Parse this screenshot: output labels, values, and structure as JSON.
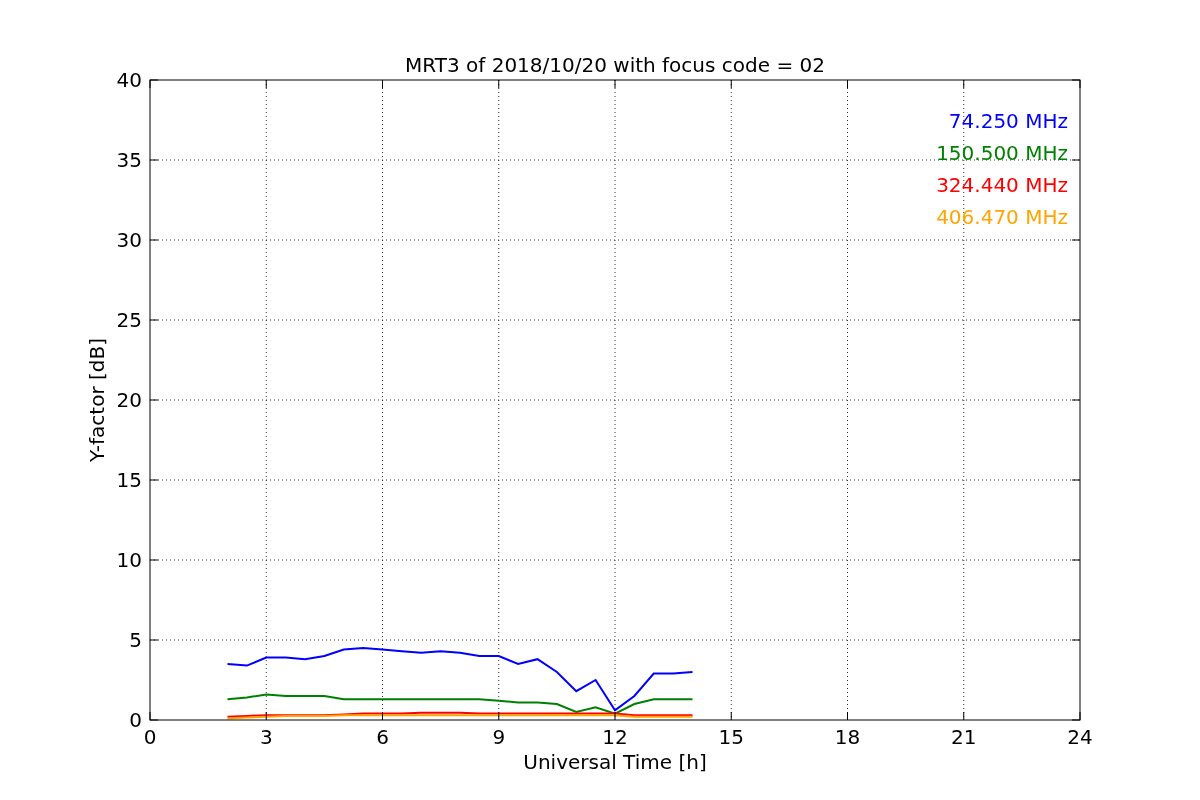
{
  "chart_data": {
    "type": "line",
    "title": "MRT3 of 2018/10/20 with focus code = 02",
    "xlabel": "Universal Time [h]",
    "ylabel": "Y-factor [dB]",
    "x": [
      2,
      2.5,
      3,
      3.5,
      4,
      4.5,
      5,
      5.5,
      6,
      6.5,
      7,
      7.5,
      8,
      8.5,
      9,
      9.5,
      10,
      10.5,
      11,
      11.5,
      12,
      12.5,
      13,
      13.5,
      14
    ],
    "series": [
      {
        "name": "74.250 MHz",
        "color": "#0000ff",
        "values": [
          3.5,
          3.4,
          3.9,
          3.9,
          3.8,
          4.0,
          4.4,
          4.5,
          4.4,
          4.3,
          4.2,
          4.3,
          4.2,
          4.0,
          4.0,
          3.5,
          3.8,
          3.0,
          1.8,
          2.5,
          0.6,
          1.5,
          2.9,
          2.9,
          3.0
        ]
      },
      {
        "name": "150.500 MHz",
        "color": "#008000",
        "values": [
          1.3,
          1.4,
          1.6,
          1.5,
          1.5,
          1.5,
          1.3,
          1.3,
          1.3,
          1.3,
          1.3,
          1.3,
          1.3,
          1.3,
          1.2,
          1.1,
          1.1,
          1.0,
          0.5,
          0.8,
          0.4,
          1.0,
          1.3,
          1.3,
          1.3
        ]
      },
      {
        "name": "324.440 MHz",
        "color": "#ff0000",
        "values": [
          0.2,
          0.25,
          0.3,
          0.3,
          0.3,
          0.3,
          0.35,
          0.4,
          0.4,
          0.4,
          0.45,
          0.45,
          0.45,
          0.4,
          0.4,
          0.4,
          0.4,
          0.4,
          0.4,
          0.4,
          0.4,
          0.3,
          0.3,
          0.3,
          0.3
        ]
      },
      {
        "name": "406.470 MHz",
        "color": "#ffa500",
        "values": [
          0.1,
          0.15,
          0.2,
          0.25,
          0.25,
          0.25,
          0.3,
          0.3,
          0.3,
          0.3,
          0.3,
          0.3,
          0.3,
          0.3,
          0.3,
          0.3,
          0.3,
          0.3,
          0.3,
          0.3,
          0.3,
          0.2,
          0.2,
          0.2,
          0.2
        ]
      }
    ],
    "grid": true,
    "xlim": [
      0,
      24
    ],
    "ylim": [
      0,
      40
    ],
    "xticks": [
      0,
      3,
      6,
      9,
      12,
      15,
      18,
      21,
      24
    ],
    "yticks": [
      0,
      5,
      10,
      15,
      20,
      25,
      30,
      35,
      40
    ]
  }
}
